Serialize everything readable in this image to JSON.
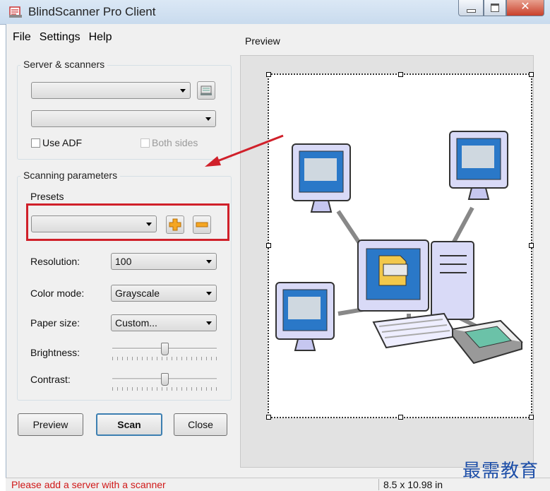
{
  "window": {
    "title": "BlindScanner Pro Client"
  },
  "menu": [
    "File",
    "Settings",
    "Help"
  ],
  "server_group": {
    "label": "Server & scanners",
    "server_value": "",
    "scanner_value": "",
    "use_adf_label": "Use ADF",
    "both_sides_label": "Both sides"
  },
  "scan_group": {
    "label": "Scanning parameters",
    "presets_label": "Presets",
    "preset_value": "",
    "resolution_label": "Resolution:",
    "resolution_value": "100",
    "color_mode_label": "Color mode:",
    "color_mode_value": "Grayscale",
    "paper_size_label": "Paper size:",
    "paper_size_value": "Custom...",
    "brightness_label": "Brightness:",
    "brightness_level": 0.5,
    "contrast_label": "Contrast:",
    "contrast_level": 0.5
  },
  "buttons": {
    "preview": "Preview",
    "scan": "Scan",
    "close": "Close"
  },
  "preview": {
    "label": "Preview"
  },
  "status": {
    "message": "Please add a server with a scanner",
    "page_size": "8.5 x 10.98 in"
  },
  "watermark": "最需教育",
  "colors": {
    "highlight_box": "#d0202a",
    "annotation_arrow": "#d0202a",
    "status_error": "#d01818",
    "watermark": "#1e4fa8"
  }
}
